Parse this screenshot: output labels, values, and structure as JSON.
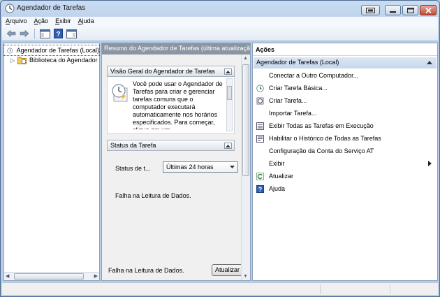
{
  "window": {
    "title": "Agendador de Tarefas"
  },
  "menu": [
    {
      "label": "Arquivo",
      "u": "A",
      "rest": "rquivo"
    },
    {
      "label": "Ação",
      "u": "A",
      "rest": "ção"
    },
    {
      "label": "Exibir",
      "u": "E",
      "rest": "xibir"
    },
    {
      "label": "Ajuda",
      "u": "Aj",
      "rest": "uda"
    }
  ],
  "tree": {
    "root": "Agendador de Tarefas (Local)",
    "child": "Biblioteca do Agendador"
  },
  "center": {
    "header": "Resumo do Agendador de Tarefas (última atualização",
    "overview": {
      "title": "Visão Geral do Agendador de Tarefas",
      "text": "Você pode usar o Agendador de Tarefas para criar e gerenciar tarefas comuns que o computador executará automaticamente nos horários especificados. Para começar, clique em um"
    },
    "status": {
      "title": "Status da Tarefa",
      "label": "Status de t...",
      "combo_value": "Últimas 24 horas",
      "message": "Falha na Leitura de Dados."
    },
    "footer": {
      "message": "Falha na Leitura de Dados.",
      "refresh_label": "Atualizar"
    }
  },
  "actions": {
    "title": "Ações",
    "group": "Agendador de Tarefas (Local)",
    "items": [
      {
        "label": "Conectar a Outro Computador...",
        "icon": "none"
      },
      {
        "label": "Criar Tarefa Básica...",
        "icon": "clock-icon"
      },
      {
        "label": "Criar Tarefa...",
        "icon": "task-icon"
      },
      {
        "label": "Importar Tarefa...",
        "icon": "none"
      },
      {
        "label": "Exibir Todas as Tarefas em Execução",
        "icon": "list-icon"
      },
      {
        "label": "Habilitar o Histórico de Todas as Tarefas",
        "icon": "history-icon"
      },
      {
        "label": "Configuração da Conta do Serviço AT",
        "icon": "none"
      },
      {
        "label": "Exibir",
        "icon": "none"
      },
      {
        "label": "Atualizar",
        "icon": "refresh-icon"
      },
      {
        "label": "Ajuda",
        "icon": "help-icon"
      }
    ]
  },
  "colors": {
    "accent": "#c6d7ec",
    "header_gray": "#8b96a3",
    "window_frame": "#b8cde8"
  }
}
